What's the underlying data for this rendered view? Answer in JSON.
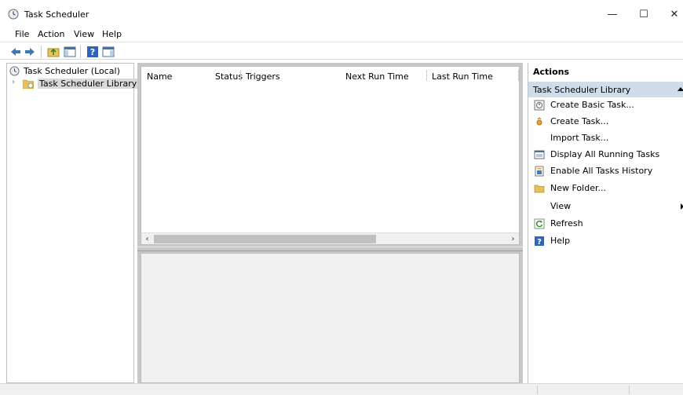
{
  "window": {
    "title": "Task Scheduler"
  },
  "menu": [
    "File",
    "Action",
    "View",
    "Help"
  ],
  "toolbar_icons": [
    "back-arrow-icon",
    "forward-arrow-icon",
    "up-folder-icon",
    "show-hide-console-tree-icon",
    "help-icon",
    "show-hide-action-pane-icon"
  ],
  "tree": {
    "root": "Task Scheduler (Local)",
    "library": "Task Scheduler Library"
  },
  "columns": [
    "Name",
    "Status",
    "Triggers",
    "Next Run Time",
    "Last Run Time"
  ],
  "actions": {
    "title": "Actions",
    "section": "Task Scheduler Library",
    "items": [
      {
        "label": "Create Basic Task...",
        "icon": "create-basic-task-icon"
      },
      {
        "label": "Create Task...",
        "icon": "create-task-icon"
      },
      {
        "label": "Import Task...",
        "icon": ""
      },
      {
        "label": "Display All Running Tasks",
        "icon": "running-tasks-icon"
      },
      {
        "label": "Enable All Tasks History",
        "icon": "history-icon"
      },
      {
        "label": "New Folder...",
        "icon": "folder-icon"
      },
      {
        "label": "View",
        "icon": ""
      },
      {
        "label": "Refresh",
        "icon": "refresh-icon"
      },
      {
        "label": "Help",
        "icon": "help-icon"
      }
    ]
  },
  "colors": {
    "accent_selection": "#cfdcea",
    "pane_border": "#bfbfbf",
    "panel_gray": "#c8c8c8"
  }
}
